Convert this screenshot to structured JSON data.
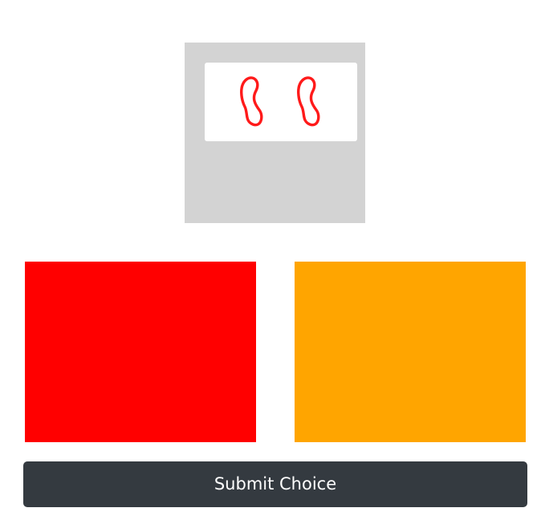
{
  "stimulus": {
    "shape_icon": "s-squiggle-icon",
    "shape_count": 2,
    "shape_stroke_color": "#ff1a1a",
    "panel_color": "#d3d3d3"
  },
  "choices": [
    {
      "color": "#ff0000"
    },
    {
      "color": "#ffa500"
    }
  ],
  "submit": {
    "label": "Submit Choice",
    "color": "#343a40"
  }
}
